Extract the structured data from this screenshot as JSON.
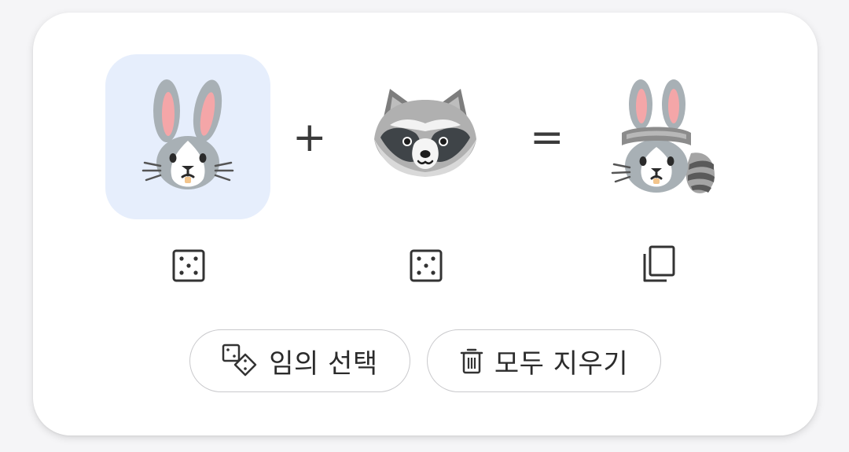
{
  "colors": {
    "card_bg": "#ffffff",
    "selected_slot_bg": "#e6eefc",
    "text": "#2b2b2b",
    "pill_border": "#c9c9cc"
  },
  "mixer": {
    "slot_left": {
      "emoji": "rabbit face",
      "selected": true,
      "action_icon": "dice-icon"
    },
    "plus_symbol": "+",
    "slot_right": {
      "emoji": "raccoon face",
      "selected": false,
      "action_icon": "dice-icon"
    },
    "equals_symbol": "=",
    "result": {
      "emoji": "rabbit with raccoon hat and tail",
      "action_icon": "copy-icon"
    }
  },
  "actions": {
    "random_label": "임의 선택",
    "random_icon": "dice-pair-icon",
    "clear_label": "모두 지우기",
    "clear_icon": "trash-icon"
  }
}
